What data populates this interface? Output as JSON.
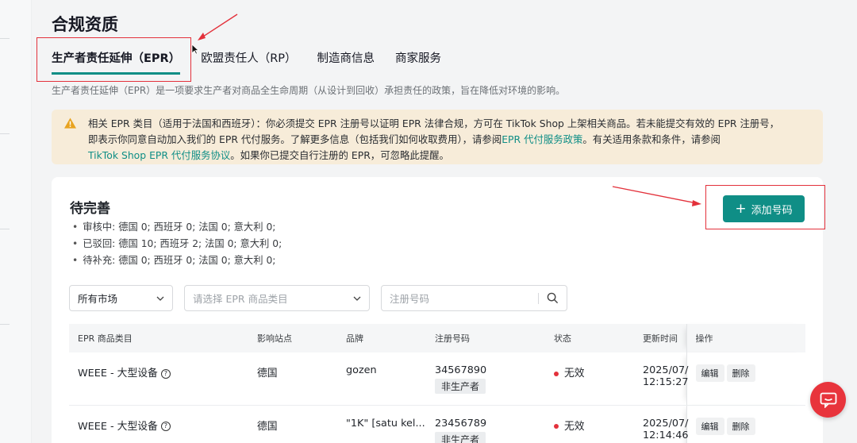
{
  "page": {
    "title": "合规资质",
    "tabs": [
      {
        "label": "生产者责任延伸（EPR）",
        "active": true
      },
      {
        "label": "欧盟责任人（RP）",
        "active": false
      },
      {
        "label": "制造商信息",
        "active": false
      },
      {
        "label": "商家服务",
        "active": false
      }
    ],
    "tab_description": "生产者责任延伸（EPR）是一项要求生产者对商品全生命周期（从设计到回收）承担责任的政策，旨在降低对环境的影响。"
  },
  "alert": {
    "line1": "相关 EPR 类目（适用于法国和西班牙）：你必须提交 EPR 注册号以证明 EPR 法律合规，方可在 TikTok Shop 上架相关商品。若未能提交有效的 EPR 注册号，",
    "line2_text": "即表示你同意自动加入我们的 EPR 代付服务。了解更多信息（包括我们如何收取费用），请参阅",
    "line2_link": "EPR 代付服务政策",
    "line2_tail": "。有关适用条款和条件，请参阅",
    "line3_link": "TikTok Shop EPR 代付服务协议",
    "line3_tail": "。如果你已提交自行注册的 EPR，可忽略此提醒。"
  },
  "pending": {
    "title": "待完善",
    "add_button": "添加号码",
    "statuses": [
      "审核中: 德国 0; 西班牙 0; 法国 0; 意大利 0;",
      "已驳回: 德国 10; 西班牙 2; 法国 0; 意大利 0;",
      "待补充: 德国 0; 西班牙 0; 法国 0; 意大利 0;"
    ]
  },
  "filters": {
    "market": "所有市场",
    "category_placeholder": "请选择 EPR 商品类目",
    "search_placeholder": "注册号码"
  },
  "table": {
    "columns": [
      "EPR 商品类目",
      "影响站点",
      "品牌",
      "注册号码",
      "状态",
      "更新时间",
      "操作"
    ],
    "rows": [
      {
        "category": "WEEE - 大型设备",
        "site": "德国",
        "brand": "gozen",
        "reg_no": "34567890",
        "tag": "非生产者",
        "status": "无效",
        "date": "2025/07/",
        "time": "12:15:27",
        "edit": "编辑",
        "delete": "删除"
      },
      {
        "category": "WEEE - 大型设备",
        "site": "德国",
        "brand": "\"1K\" [satu kel...",
        "reg_no": "23456789",
        "tag": "非生产者",
        "status": "无效",
        "date": "2025/07/",
        "time": "12:14:46",
        "edit": "编辑",
        "delete": "删除"
      }
    ]
  },
  "colors": {
    "accent": "#0f8e86",
    "danger": "#e3313b",
    "alert_bg": "#f7ecd9"
  }
}
